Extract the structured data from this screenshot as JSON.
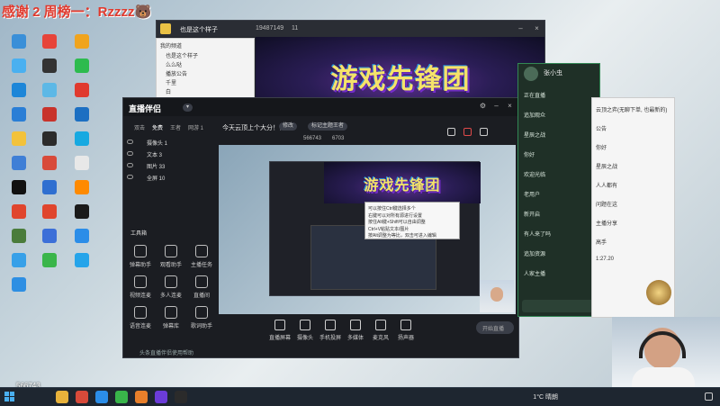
{
  "overlay": {
    "text": "感谢 2 周榜一：Rzzzz🐻"
  },
  "desktop_icons": [
    {
      "label": "",
      "color": "#3a8fd8"
    },
    {
      "label": "",
      "color": "#e7443a"
    },
    {
      "label": "",
      "color": "#f0a41e"
    },
    {
      "label": "",
      "color": "#4ab0f0"
    },
    {
      "label": "",
      "color": "#333"
    },
    {
      "label": "",
      "color": "#2dbb4e"
    },
    {
      "label": "",
      "color": "#1d86d8"
    },
    {
      "label": "",
      "color": "#5db8e6"
    },
    {
      "label": "",
      "color": "#e03a2e"
    },
    {
      "label": "",
      "color": "#2a7ed6"
    },
    {
      "label": "",
      "color": "#c8332b"
    },
    {
      "label": "",
      "color": "#1c6fc2"
    },
    {
      "label": "",
      "color": "#f3c23b"
    },
    {
      "label": "",
      "color": "#2b2b2b"
    },
    {
      "label": "",
      "color": "#17a9e1"
    },
    {
      "label": "",
      "color": "#3f7fd6"
    },
    {
      "label": "",
      "color": "#d84a3a"
    },
    {
      "label": "",
      "color": "#e8e8e8"
    },
    {
      "label": "",
      "color": "#111"
    },
    {
      "label": "",
      "color": "#2f6fd0"
    },
    {
      "label": "",
      "color": "#ff8a00"
    },
    {
      "label": "",
      "color": "#e0452d"
    },
    {
      "label": "",
      "color": "#e0452d"
    },
    {
      "label": "",
      "color": "#1a1a1a"
    },
    {
      "label": "",
      "color": "#4a7c3b"
    },
    {
      "label": "",
      "color": "#3c6fd8"
    },
    {
      "label": "",
      "color": "#2b8de8"
    },
    {
      "label": "",
      "color": "#37a0e8"
    },
    {
      "label": "",
      "color": "#3ab54a"
    },
    {
      "label": "",
      "color": "#25a4ea"
    },
    {
      "label": "",
      "color": "#2e8fe3"
    }
  ],
  "stream_window": {
    "room_title": "也是这个样子",
    "room_id": "19487149",
    "viewers": "11",
    "banner_text": "游戏先锋团"
  },
  "qq_panel": {
    "header": "我的频道",
    "items": [
      "也是这个样子",
      "么么哒",
      "播放公告",
      "千里",
      "白"
    ]
  },
  "broadcaster": {
    "app_name": "直播伴侣",
    "tabs": [
      "双击",
      "免费",
      "王者",
      "网游 1"
    ],
    "stream_title": "今天云顶上个大分！！",
    "edit_label": "修改",
    "category": "标记主题王者",
    "live_id": "566743",
    "likes": "6703",
    "scenes": [
      {
        "label": "摄像头 1"
      },
      {
        "label": "文本 3"
      },
      {
        "label": "图片 33"
      },
      {
        "label": "全屏 10"
      }
    ],
    "toolbox_title": "工具箱",
    "tools": [
      "弹幕助手",
      "观看助手",
      "主播任务",
      "视频连麦",
      "多人连麦",
      "直播间",
      "语音连麦",
      "弹幕库",
      "歌词助手"
    ],
    "bottom_tools": [
      "直播屏幕",
      "摄像头",
      "手机投屏",
      "多媒体",
      "麦克风",
      "扬声器"
    ],
    "start_label": "开始直播",
    "footer_text": "头条直播伴侣使用帮助"
  },
  "tooltip": {
    "lines": [
      "可以按住Ctrl键选择多个",
      "右键可以对所有源进行设置",
      "按住Alt键+Shift可以自由调整",
      "Ctrl+V粘贴文本/图片",
      "按Alt调整为等比，双击可进入编辑"
    ]
  },
  "chat_panel": {
    "user": "张小虫",
    "lines": [
      "正在直播",
      "追加观众",
      "星辰之战",
      "你好",
      "欢迎光临",
      "老用户",
      "新开启",
      "有人来了吗",
      "追加资源",
      "人家主播"
    ],
    "side_lines": [
      "云顶之弈(无聊下单, 也最新的)",
      "公告",
      "你好",
      "星辰之战",
      "人人都有",
      "问题在这",
      "主播分享",
      "高手",
      "1:27.20"
    ]
  },
  "taskbar": {
    "weather": "1°C 晴朗",
    "time": "",
    "apps": [
      {
        "color": "#e8b23b"
      },
      {
        "color": "#d84a3a"
      },
      {
        "color": "#2b8de8"
      },
      {
        "color": "#39b54a"
      },
      {
        "color": "#e87f2b"
      },
      {
        "color": "#6b3cd8"
      },
      {
        "color": "#2b2b2b"
      }
    ]
  },
  "watermark": {
    "text": "566743"
  }
}
